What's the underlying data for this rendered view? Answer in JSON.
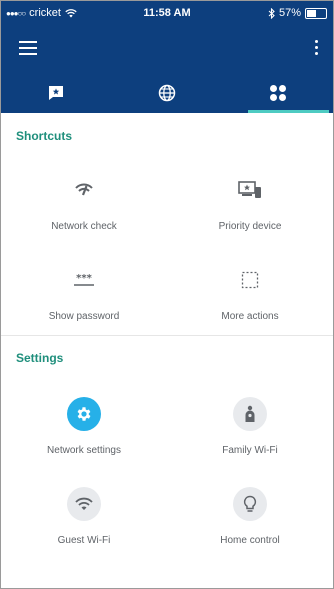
{
  "status_bar": {
    "carrier": "cricket",
    "time": "11:58 AM",
    "battery": "57%",
    "battery_level": 0.57
  },
  "app_bar": {
    "menu_icon": "hamburger-icon",
    "overflow_icon": "more-vert-icon"
  },
  "tabs": [
    {
      "icon": "feedback-icon"
    },
    {
      "icon": "globe-icon"
    },
    {
      "icon": "apps-icon",
      "active": true
    }
  ],
  "shortcuts": {
    "title": "Shortcuts",
    "items": [
      {
        "label": "Network check",
        "icon": "network-check-icon"
      },
      {
        "label": "Priority device",
        "icon": "priority-device-icon"
      },
      {
        "label": "Show password",
        "icon": "password-icon"
      },
      {
        "label": "More actions",
        "icon": "more-actions-icon"
      }
    ]
  },
  "settings": {
    "title": "Settings",
    "items": [
      {
        "label": "Network settings",
        "icon": "gear-icon"
      },
      {
        "label": "Family Wi-Fi",
        "icon": "family-icon"
      },
      {
        "label": "Guest Wi-Fi",
        "icon": "wifi-icon"
      },
      {
        "label": "Home control",
        "icon": "lightbulb-icon"
      }
    ]
  },
  "colors": {
    "header": "#0d3f7e",
    "tab_indicator": "#4ecbc2",
    "section_title": "#1f8f7c",
    "accent_circle": "#26b0e8"
  }
}
